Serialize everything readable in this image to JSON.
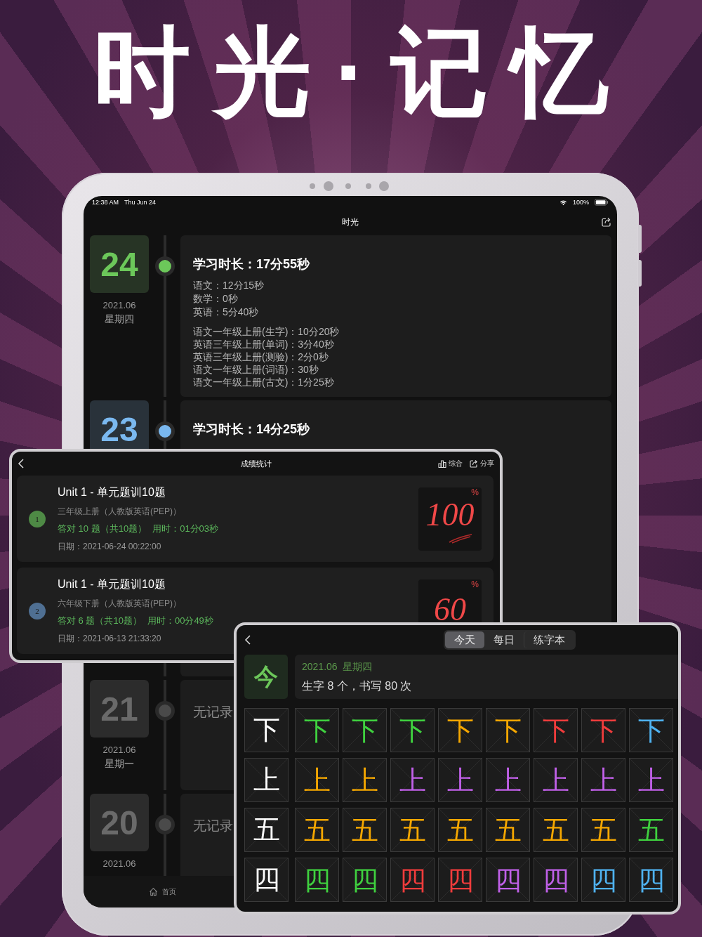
{
  "headline": "时光·记忆",
  "tablet": {
    "status_bar": {
      "time": "12:38 AM",
      "date": "Thu Jun 24",
      "battery": "100%"
    },
    "title": "时光",
    "days": [
      {
        "kind": "record",
        "day": "24",
        "month": "2021.06",
        "weekday": "星期四",
        "color": "#6cc75a",
        "summary": "学习时长：17分55秒",
        "subjects": [
          "语文：12分15秒",
          "数学：0秒",
          "英语：5分40秒"
        ],
        "books": [
          "语文一年级上册(生字)：10分20秒",
          "英语三年级上册(单词)：3分40秒",
          "英语三年级上册(测验)：2分0秒",
          "语文一年级上册(词语)：30秒",
          "语文一年级上册(古文)：1分25秒"
        ]
      },
      {
        "kind": "record",
        "day": "23",
        "color": "#7ab8ef",
        "summary": "学习时长：14分25秒"
      },
      {
        "kind": "empty",
        "day": "21",
        "month": "2021.06",
        "weekday": "星期一",
        "color": "#4a4a4a",
        "summary": "无记录"
      },
      {
        "kind": "empty",
        "day": "20",
        "month": "2021.06",
        "color": "#4a4a4a",
        "summary": "无记录"
      }
    ],
    "tab_bar": [
      {
        "label": "首页"
      }
    ]
  },
  "scores": {
    "title": "成绩统计",
    "actions": [
      {
        "kind": "chart",
        "label": "综合"
      },
      {
        "kind": "share",
        "label": "分享"
      }
    ],
    "results": [
      {
        "index": "1",
        "color": "#4e8a45",
        "title": "Unit 1 - 单元题训10题",
        "book": "三年级上册（人教版英语(PEP)）",
        "correct": "答对 10 题（共10题）",
        "time": "用时：01分03秒",
        "date": "日期：2021-06-24 00:22:00",
        "score": "100",
        "unit": "%",
        "flourish": true
      },
      {
        "index": "2",
        "color": "#4f6f92",
        "title": "Unit 1 - 单元题训10题",
        "book": "六年级下册（人教版英语(PEP)）",
        "correct": "答对 6 题（共10题）",
        "time": "用时：00分49秒",
        "date": "日期：2021-06-13 21:33:20",
        "score": "60",
        "unit": "%",
        "flourish": false
      }
    ]
  },
  "writing": {
    "tabs": [
      {
        "label": "今天",
        "selected": true
      },
      {
        "label": "每日",
        "selected": false
      },
      {
        "label": "练字本",
        "selected": false
      }
    ],
    "summary": {
      "badge": "今",
      "date": "2021.06  星期四",
      "text": "生字 8 个，书写 80 次"
    },
    "rows": [
      {
        "model": "下",
        "attempts": [
          {
            "char": "下",
            "color": "#3fd13f"
          },
          {
            "char": "下",
            "color": "#3fd13f"
          },
          {
            "char": "下",
            "color": "#3fd13f"
          },
          {
            "char": "下",
            "color": "#f5a700"
          },
          {
            "char": "下",
            "color": "#f5a700"
          },
          {
            "char": "下",
            "color": "#f03c3c"
          },
          {
            "char": "下",
            "color": "#f03c3c"
          },
          {
            "char": "下",
            "color": "#4fb2f0"
          }
        ]
      },
      {
        "model": "上",
        "attempts": [
          {
            "char": "上",
            "color": "#f5a700"
          },
          {
            "char": "上",
            "color": "#f5a700"
          },
          {
            "char": "上",
            "color": "#c060e8"
          },
          {
            "char": "上",
            "color": "#c060e8"
          },
          {
            "char": "上",
            "color": "#c060e8"
          },
          {
            "char": "上",
            "color": "#c060e8"
          },
          {
            "char": "上",
            "color": "#c060e8"
          },
          {
            "char": "上",
            "color": "#c060e8"
          }
        ]
      },
      {
        "model": "五",
        "attempts": [
          {
            "char": "五",
            "color": "#f5a700"
          },
          {
            "char": "五",
            "color": "#f5a700"
          },
          {
            "char": "五",
            "color": "#f5a700"
          },
          {
            "char": "五",
            "color": "#f5a700"
          },
          {
            "char": "五",
            "color": "#f5a700"
          },
          {
            "char": "五",
            "color": "#f5a700"
          },
          {
            "char": "五",
            "color": "#f5a700"
          },
          {
            "char": "五",
            "color": "#3fd13f"
          }
        ]
      },
      {
        "model": "四",
        "attempts": [
          {
            "char": "四",
            "color": "#3fd13f"
          },
          {
            "char": "四",
            "color": "#3fd13f"
          },
          {
            "char": "四",
            "color": "#f03c3c"
          },
          {
            "char": "四",
            "color": "#f03c3c"
          },
          {
            "char": "四",
            "color": "#c060e8"
          },
          {
            "char": "四",
            "color": "#c060e8"
          },
          {
            "char": "四",
            "color": "#4fb2f0"
          },
          {
            "char": "四",
            "color": "#4fb2f0"
          }
        ]
      }
    ]
  }
}
